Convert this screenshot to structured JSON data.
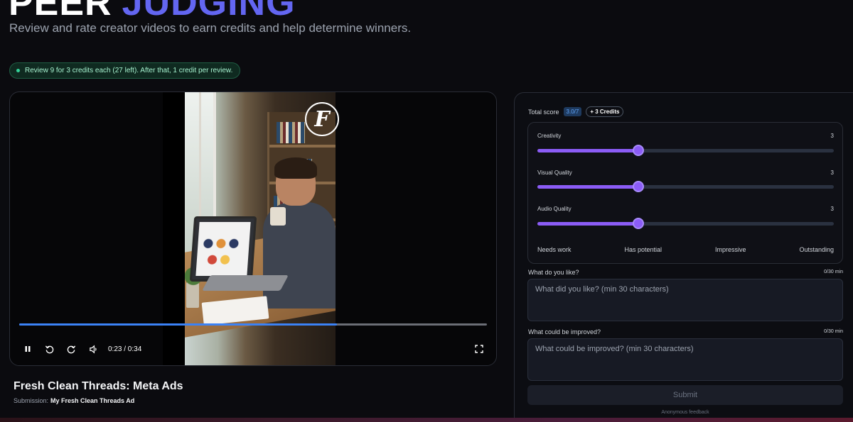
{
  "header": {
    "title_word1": "PEER",
    "title_word2": "JUDGING",
    "subtitle": "Review and rate creator videos to earn credits and help determine winners.",
    "credit_notice": "Review 9 for 3 credits each (27 left). After that, 1 credit per review."
  },
  "video": {
    "progress": 0.68,
    "current_time": "0:23 / 0:34",
    "title": "Fresh Clean Threads: Meta Ads",
    "submission_label": "Submission:",
    "submission_name": "My Fresh Clean Threads Ad",
    "logo_letter": "F"
  },
  "scoring": {
    "total_label": "Total score",
    "total_value": "3.0/7",
    "credits_badge": "+ 3 Credits",
    "criteria": [
      {
        "label": "Creativity",
        "value": "3",
        "level": 0.34
      },
      {
        "label": "Visual Quality",
        "value": "3",
        "level": 0.34
      },
      {
        "label": "Audio Quality",
        "value": "3",
        "level": 0.34
      }
    ],
    "scale": [
      "Needs work",
      "Has potential",
      "Impressive",
      "Outstanding"
    ]
  },
  "feedback": {
    "like_label": "What do you like?",
    "like_count": "0/30 min",
    "like_placeholder": "What did you like? (min 30 characters)",
    "improve_label": "What could be improved?",
    "improve_count": "0/30 min",
    "improve_placeholder": "What could be improved? (min 30 characters)",
    "submit_label": "Submit",
    "anonymous_note": "Anonymous feedback"
  },
  "colors": {
    "accent": "#6366f1",
    "slider": "#8b5cf6",
    "progress": "#3b82f6",
    "success": "#34d399"
  },
  "icons": [
    "pause-icon",
    "rewind-icon",
    "forward-icon",
    "volume-icon",
    "fullscreen-icon"
  ]
}
